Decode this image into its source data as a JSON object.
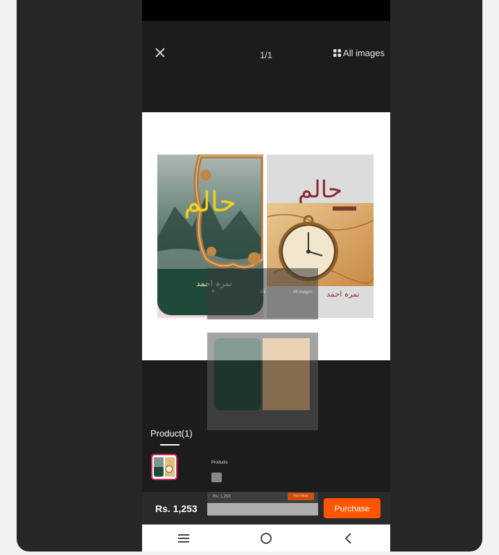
{
  "viewer": {
    "counter": "1/1",
    "all_images_label": "All images"
  },
  "covers": {
    "left_title": "حالم",
    "left_author": "نمرہ احمد",
    "right_title": "حالم",
    "right_author": "نمرہ احمد"
  },
  "products": {
    "tab_label": "Product(1)"
  },
  "bottom_bar": {
    "price": "Rs. 1,253",
    "purchase_label": "Purchase"
  },
  "overlay": {
    "tab_label": "Products",
    "price": "Rs. 1,253",
    "purchase_label": "Purchase",
    "all_images_label": "All images",
    "counter": "1/1"
  },
  "colors": {
    "accent": "#ff5500",
    "thumb_border": "#e0245e",
    "cover_green": "#1f4a3a",
    "title_yellow": "#f0d020",
    "title_maroon": "#8a2a30"
  },
  "icons": {
    "close": "close-icon",
    "all_images": "grid-icon",
    "nav_menu": "menu-icon",
    "nav_home": "home-circle-icon",
    "nav_back": "back-chevron-icon"
  }
}
